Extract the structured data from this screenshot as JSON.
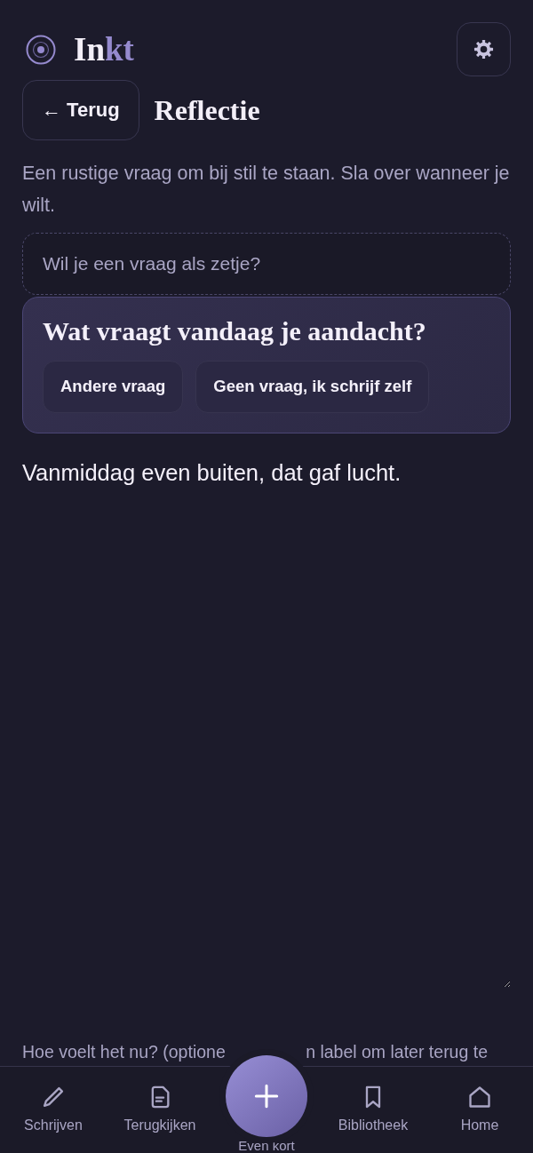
{
  "header": {
    "logo": {
      "plain": "In",
      "accent": "kt"
    }
  },
  "back_bar": {
    "back_button": "← Terug",
    "title": "Reflectie"
  },
  "intro": "Een rustige vraag om bij stil te staan. Sla over wanneer je wilt.",
  "prompt_field": {
    "placeholder": "Wil je een vraag als zetje?"
  },
  "prompt_card": {
    "question": "Wat vraagt vandaag je aandacht?",
    "buttons": [
      "Andere vraag",
      "Geen vraag, ik schrijf zelf"
    ]
  },
  "entry": {
    "value": "Vanmiddag even buiten, dat gaf lucht."
  },
  "mood_label": {
    "parts": [
      "Hoe voelt het nu? (optione",
      "n label om later terug te"
    ]
  },
  "nav": {
    "items": [
      {
        "label": "Schrijven",
        "kind": "tab",
        "selected": false
      },
      {
        "label": "Terugkijken",
        "kind": "tab",
        "selected": false
      },
      {
        "label": "Even kort",
        "kind": "action",
        "selected": false
      },
      {
        "label": "Bibliotheek",
        "kind": "tab",
        "selected": false
      },
      {
        "label": "Home",
        "kind": "tab",
        "selected": false
      }
    ]
  }
}
